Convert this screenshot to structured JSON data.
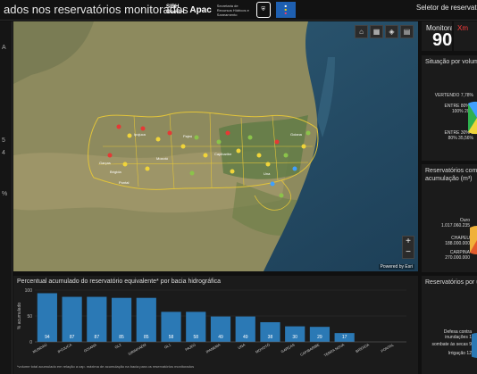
{
  "header": {
    "title": "ados nos reservatórios monitorados",
    "logo_sirh": "SIRH",
    "logo_georh": "GeoRH",
    "logo_apac": "Apac",
    "logo_secretaria": "Secretaria de Recursos Hídricos e Saneamento",
    "selector_label": "Seletor de reservatório:"
  },
  "left_strip": {
    "labels": [
      "A",
      "5",
      "4",
      "%"
    ]
  },
  "map": {
    "tools": [
      "home-icon",
      "grid-icon",
      "layers-icon",
      "basemap-icon"
    ],
    "zoom_in": "+",
    "zoom_out": "−",
    "attribution": "Powered by Esri",
    "basin_labels": [
      "Ipojuca",
      "Capibaribe",
      "Goiana",
      "Una",
      "Moxotó",
      "Pajeú",
      "Brígida",
      "Garças",
      "Pontal"
    ]
  },
  "kpi": {
    "label": "Monitorado",
    "value": "90",
    "second_label": "Xm"
  },
  "situacao": {
    "title": "Situação por volume",
    "labels": [
      "VERTENDO 7,78%",
      "ENTRE 80% e 100% 20%",
      "ENTRE 30% e 80% 35,56%"
    ],
    "colors": [
      "#3fa0ff",
      "#2eb14e",
      "#f0d43a"
    ]
  },
  "acumulacao": {
    "title": "Reservatórios com m",
    "title2": "acumulação (m³)",
    "labels": [
      [
        "Ouro",
        "1.017.060.235"
      ],
      [
        "CHAPEU",
        "188.000.000"
      ],
      [
        "CARPINA",
        "270.000.000"
      ]
    ]
  },
  "usos": {
    "title": "Reservatórios por uso",
    "labels": [
      [
        "Defesa contra",
        "inundações 1"
      ],
      [
        "sombate às secas 9"
      ],
      [
        "Irrigação 12"
      ]
    ]
  },
  "bar_chart_text": {
    "title": "Percentual acumulado do reservatório equivalente* por bacia hidrográfica",
    "footnote": "*volume total acumulado em relação a cap. máxima de acumulação na bacia para os reservatórios monitorados"
  },
  "chart_data": {
    "type": "bar",
    "title": "Percentual acumulado do reservatório equivalente* por bacia hidrográfica",
    "ylabel": "% acumulado",
    "ylim": [
      0,
      100
    ],
    "yticks": [
      0,
      50,
      100
    ],
    "categories": [
      "MUNDAÚ",
      "IPOJUCA",
      "GOIANA",
      "GL2",
      "SIRINHAÉM",
      "GL1",
      "PAJEÚ",
      "IPANEMA",
      "UNA",
      "MOXOTÓ",
      "GARÇAS",
      "CAPIBARIBE",
      "TERRA NOVA",
      "BRÍGIDA",
      "PONTAL"
    ],
    "values": [
      94,
      87,
      87,
      85,
      85,
      58,
      58,
      49,
      49,
      38,
      30,
      29,
      17,
      0,
      0
    ],
    "labels": [
      "94",
      "87",
      "87",
      "85",
      "85",
      "58",
      "58",
      "49",
      "49",
      "38",
      "30",
      "29",
      "17",
      "",
      ""
    ],
    "bar_color": "#2b79b5",
    "grid": true
  }
}
